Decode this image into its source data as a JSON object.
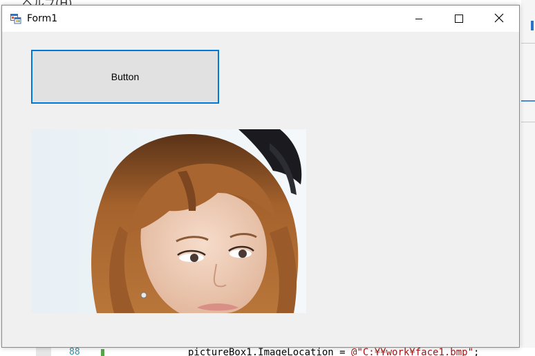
{
  "background": {
    "top_text": "ヘルプ(H)",
    "line_number": "88",
    "code_prefix": "pictureBox1.ImageLocation = ",
    "code_string": "@\"C:¥¥work¥face1.bmp\"",
    "code_suffix": ";"
  },
  "window": {
    "title": "Form1",
    "icon": "winforms-app-icon",
    "controls": {
      "minimize": "minimize-icon",
      "maximize": "maximize-icon",
      "close": "close-icon"
    }
  },
  "form": {
    "button_label": "Button",
    "picture_box": "portrait-photo"
  },
  "colors": {
    "accent": "#0078d7",
    "form_bg": "#f0f0f0",
    "button_bg": "#e1e1e1"
  }
}
